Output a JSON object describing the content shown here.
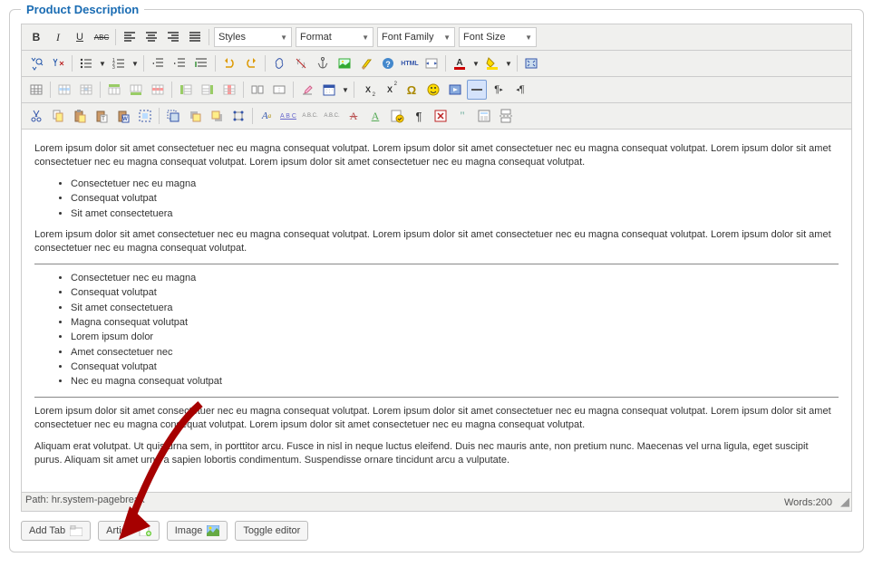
{
  "panel": {
    "title": "Product Description"
  },
  "toolbar": {
    "styles": "Styles",
    "format": "Format",
    "fontfamily": "Font Family",
    "fontsize": "Font Size",
    "bold": "B",
    "italic": "I",
    "underline": "U",
    "strike": "ABC",
    "html": "HTML",
    "sub": "X",
    "sup": "X",
    "abc": "A B C",
    "abc2": "A.B.C."
  },
  "content": {
    "p1": "Lorem ipsum dolor sit amet consectetuer nec eu magna consequat volutpat. Lorem ipsum dolor sit amet consectetuer nec eu magna consequat volutpat. Lorem ipsum dolor sit amet consectetuer nec eu magna consequat volutpat. Lorem ipsum dolor sit amet consectetuer nec eu magna consequat volutpat.",
    "list1": [
      "Consectetuer nec eu magna",
      "Consequat volutpat",
      "Sit amet consectetuera"
    ],
    "p2": "Lorem ipsum dolor sit amet consectetuer nec eu magna consequat volutpat. Lorem ipsum dolor sit amet consectetuer nec eu magna consequat volutpat. Lorem ipsum dolor sit amet consectetuer nec eu magna consequat volutpat.",
    "list2": [
      "Consectetuer nec eu magna",
      "Consequat volutpat",
      "Sit amet consectetuera",
      "Magna consequat volutpat",
      "Lorem ipsum dolor",
      "Amet consectetuer nec",
      "Consequat volutpat",
      "Nec eu magna consequat volutpat"
    ],
    "p3": "Lorem ipsum dolor sit amet consectetuer nec eu magna consequat volutpat. Lorem ipsum dolor sit amet consectetuer nec eu magna consequat volutpat. Lorem ipsum dolor sit amet consectetuer nec eu magna consequat volutpat. Lorem ipsum dolor sit amet consectetuer nec eu magna consequat volutpat.",
    "p4": "Aliquam erat volutpat. Ut quis urna sem, in porttitor arcu. Fusce in nisl in neque luctus eleifend. Duis nec mauris ante, non pretium nunc. Maecenas vel urna ligula, eget suscipit purus. Aliquam sit amet urna a sapien lobortis condimentum. Suspendisse ornare tincidunt arcu a vulputate."
  },
  "statusbar": {
    "path_label": "Path:",
    "path_value": "hr.system-pagebreak",
    "words_label": "Words:",
    "words_value": "200"
  },
  "buttons": {
    "addtab": "Add Tab",
    "article": "Article",
    "image": "Image",
    "toggle": "Toggle editor"
  }
}
